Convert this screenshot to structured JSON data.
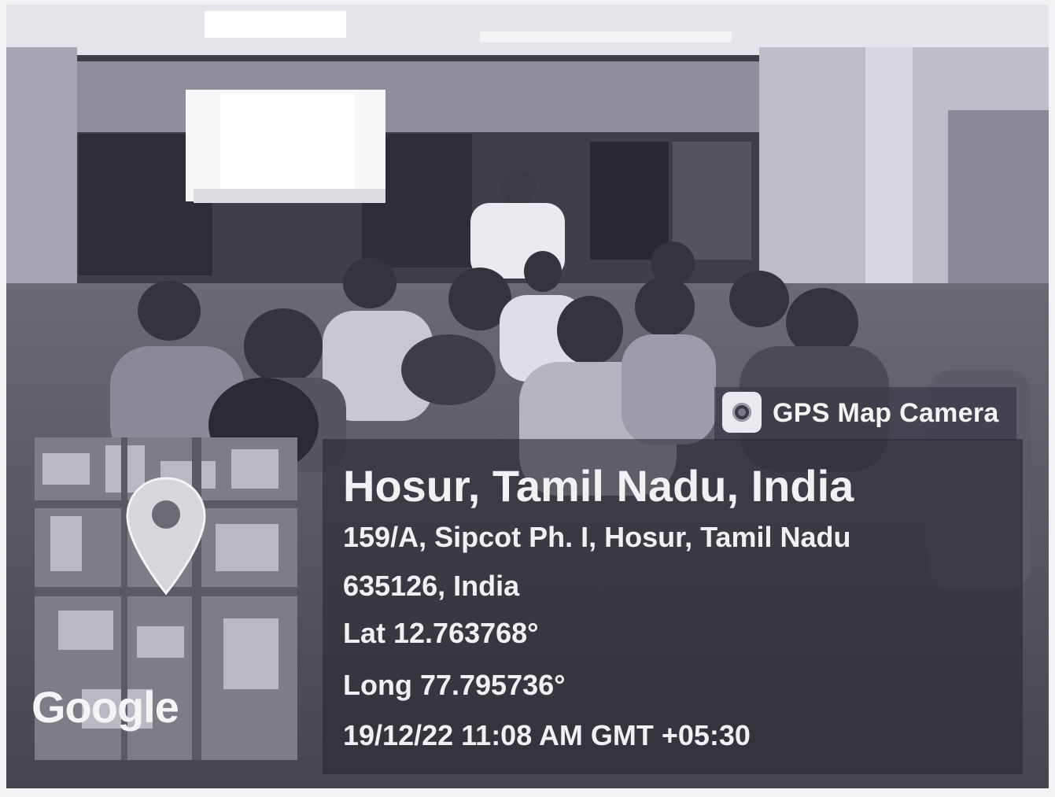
{
  "watermark": {
    "app_label": "GPS Map Camera",
    "icon": "camera-lens-icon"
  },
  "location": {
    "title": "Hosur, Tamil Nadu, India",
    "address_line1": "159/A, Sipcot Ph. I, Hosur, Tamil Nadu",
    "address_line2": "635126, India",
    "latitude": "Lat 12.763768°",
    "longitude": "Long 77.795736°",
    "datetime": "19/12/22 11:08 AM GMT +05:30"
  },
  "map": {
    "brand": "Google",
    "pin_icon": "map-pin-icon"
  },
  "colors": {
    "overlay_panel": "#2f2f38",
    "overlay_text": "#f1f1f5"
  }
}
